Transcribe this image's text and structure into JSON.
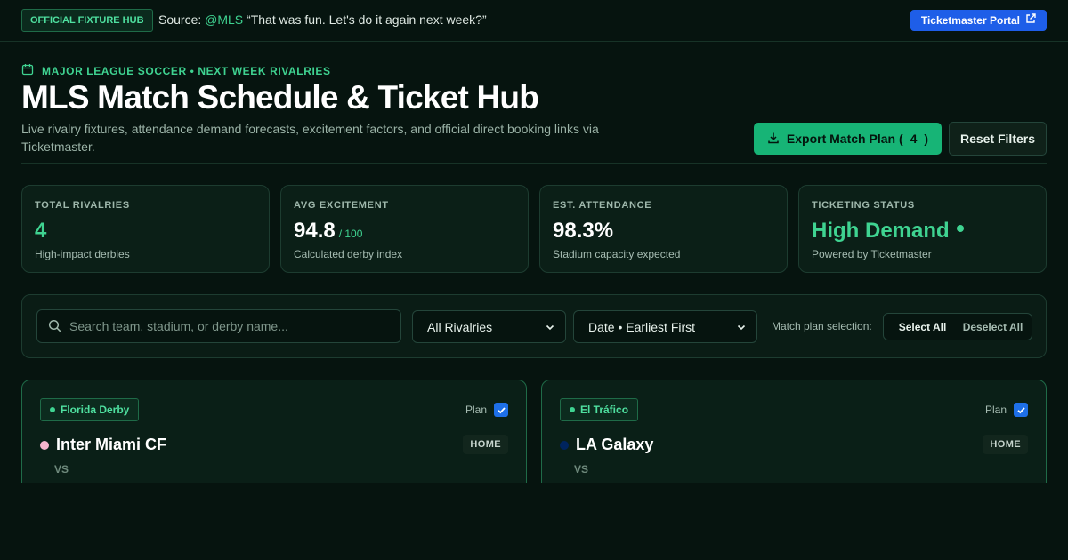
{
  "topbar": {
    "badge": "OFFICIAL FIXTURE HUB",
    "source_prefix": "Source:",
    "source_handle": "@MLS",
    "quote": "“That was fun. Let's do it again next week?”",
    "portal_button": "Ticketmaster Portal"
  },
  "header": {
    "eyebrow": "MAJOR LEAGUE SOCCER • NEXT WEEK RIVALRIES",
    "title": "MLS Match Schedule & Ticket Hub",
    "subtitle": "Live rivalry fixtures, attendance demand forecasts, excitement factors, and official direct booking links via Ticketmaster.",
    "export_label_prefix": "Export Match Plan (",
    "export_count": "4",
    "export_label_suffix": ")",
    "reset_label": "Reset Filters"
  },
  "stats": [
    {
      "label": "TOTAL RIVALRIES",
      "value": "4",
      "suffix": "",
      "note": "High-impact derbies"
    },
    {
      "label": "AVG EXCITEMENT",
      "value": "94.8",
      "suffix": "/ 100",
      "note": "Calculated derby index"
    },
    {
      "label": "EST. ATTENDANCE",
      "value": "98.3%",
      "suffix": "",
      "note": "Stadium capacity expected"
    },
    {
      "label": "TICKETING STATUS",
      "value": "High Demand",
      "suffix": "",
      "note": "Powered by Ticketmaster"
    }
  ],
  "filters": {
    "search_placeholder": "Search team, stadium, or derby name...",
    "rivalry_select": "All Rivalries",
    "sort_select": "Date • Earliest First",
    "selection_label": "Match plan selection:",
    "select_all": "Select All",
    "deselect_all": "Deselect All"
  },
  "matches": [
    {
      "derby": "Florida Derby",
      "plan_label": "Plan",
      "planned": true,
      "home_team": "Inter Miami CF",
      "home_color": "#f7b5cd",
      "home_badge": "HOME",
      "vs": "VS"
    },
    {
      "derby": "El Tráfico",
      "plan_label": "Plan",
      "planned": true,
      "home_team": "LA Galaxy",
      "home_color": "#00245d",
      "home_badge": "HOME",
      "vs": "VS"
    }
  ],
  "colors": {
    "accent": "#3fd391",
    "primary_button": "#17b476",
    "portal_button": "#1e5ee8",
    "background": "#06140f"
  }
}
